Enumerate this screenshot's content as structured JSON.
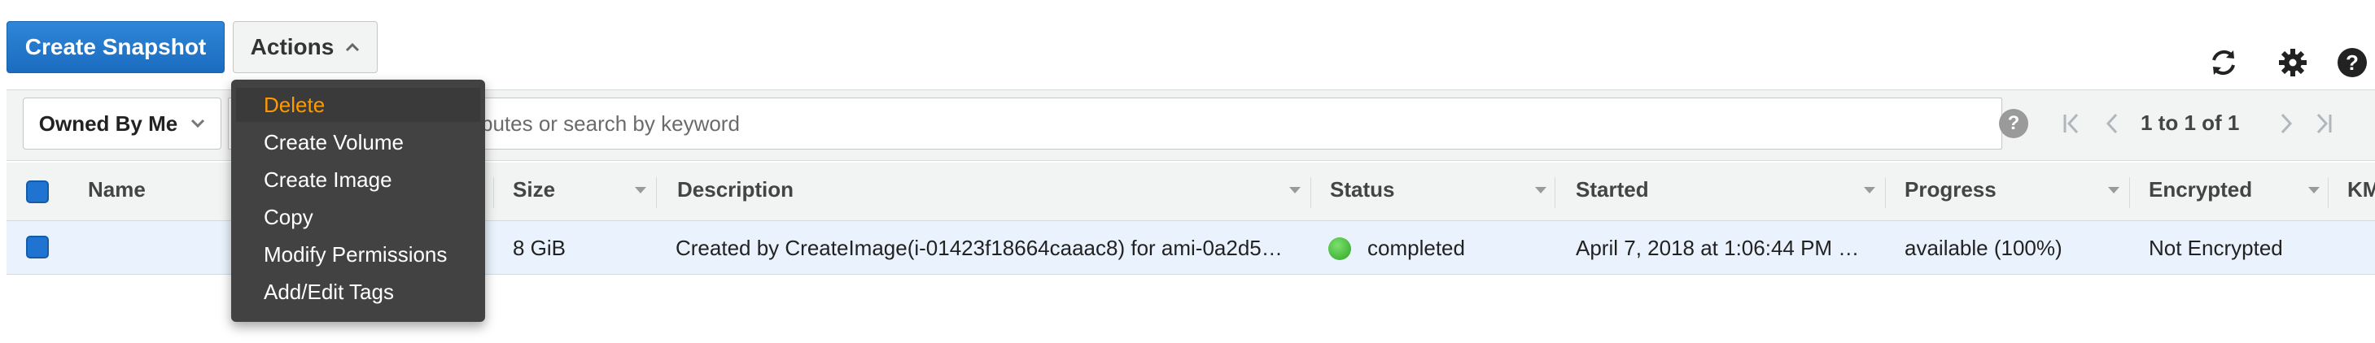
{
  "toolbar": {
    "create_snapshot_label": "Create Snapshot",
    "actions_label": "Actions"
  },
  "filter": {
    "owned_by_label": "Owned By Me",
    "search_placeholder_fragment": "butes or search by keyword",
    "help_glyph": "?"
  },
  "pagination": {
    "text": "1 to 1 of 1"
  },
  "table": {
    "columns": [
      "Name",
      "Size",
      "Description",
      "Status",
      "Started",
      "Progress",
      "Encrypted",
      "KM"
    ],
    "rows": [
      {
        "name": "",
        "size": "8 GiB",
        "description": "Created by CreateImage(i-01423f18664caaac8) for ami-0a2d5…",
        "status": "completed",
        "started": "April 7, 2018 at 1:06:44 PM …",
        "progress": "available (100%)",
        "encrypted": "Not Encrypted"
      }
    ]
  },
  "actions_menu": {
    "items": [
      "Delete",
      "Create Volume",
      "Create Image",
      "Copy",
      "Modify Permissions",
      "Add/Edit Tags"
    ],
    "highlighted_index": 0
  },
  "icons": {
    "refresh": "refresh-icon",
    "settings": "gear-icon",
    "help": "help-icon"
  },
  "colors": {
    "primary_button": "#1a6cbf",
    "menu_highlight_text": "#ff9900",
    "status_completed": "#2fa524",
    "selected_row": "#eaf3fd"
  }
}
